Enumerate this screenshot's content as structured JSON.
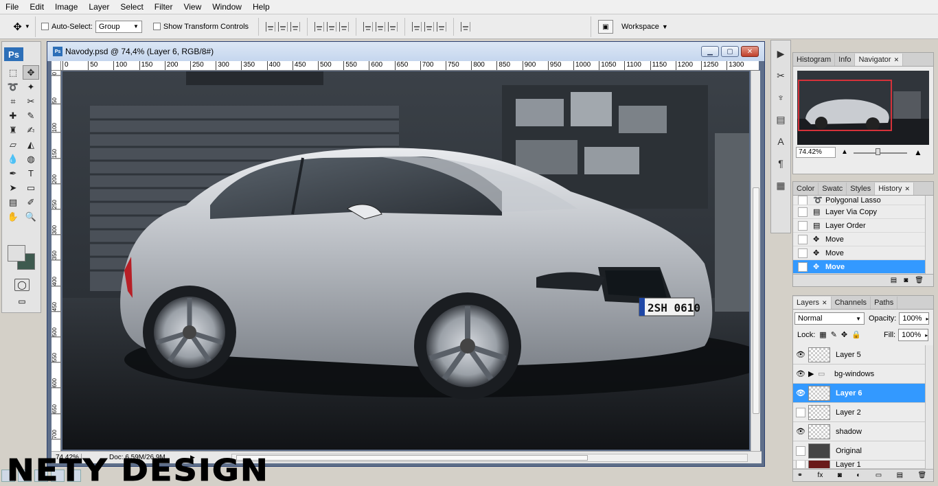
{
  "menu": [
    "File",
    "Edit",
    "Image",
    "Layer",
    "Select",
    "Filter",
    "View",
    "Window",
    "Help"
  ],
  "options": {
    "auto_select_label": "Auto-Select:",
    "auto_select_value": "Group",
    "show_transform_label": "Show Transform Controls",
    "workspace_label": "Workspace"
  },
  "toolbox": {
    "badge": "Ps"
  },
  "document": {
    "title": "Navody.psd @ 74,4% (Layer 6, RGB/8#)",
    "ruler_h": [
      "0",
      "50",
      "100",
      "150",
      "200",
      "250",
      "300",
      "350",
      "400",
      "450",
      "500",
      "550",
      "600",
      "650",
      "700",
      "750",
      "800",
      "850",
      "900",
      "950",
      "1000",
      "1050",
      "1100",
      "1150",
      "1200",
      "1250",
      "1300"
    ],
    "ruler_v": [
      "0",
      "50",
      "100",
      "150",
      "200",
      "250",
      "300",
      "350",
      "400",
      "450",
      "500",
      "550",
      "600",
      "650",
      "700"
    ],
    "zoom": "74,42%",
    "doc_size": "Doc: 6,59M/26,9M",
    "plate": "2SH 0610"
  },
  "navigator": {
    "tabs": [
      "Histogram",
      "Info",
      "Navigator"
    ],
    "zoom": "74.42%"
  },
  "history": {
    "tabs": [
      "Color",
      "Swatc",
      "Styles",
      "History"
    ],
    "items": [
      {
        "label": "Polygonal Lasso",
        "icon": "lasso"
      },
      {
        "label": "Layer Via Copy",
        "icon": "doc"
      },
      {
        "label": "Layer Order",
        "icon": "doc"
      },
      {
        "label": "Move",
        "icon": "move"
      },
      {
        "label": "Move",
        "icon": "move"
      },
      {
        "label": "Move",
        "icon": "move"
      }
    ]
  },
  "layers": {
    "tabs": [
      "Layers",
      "Channels",
      "Paths"
    ],
    "blend_mode": "Normal",
    "opacity_label": "Opacity:",
    "opacity": "100%",
    "lock_label": "Lock:",
    "fill_label": "Fill:",
    "fill": "100%",
    "items": [
      {
        "name": "Layer 5",
        "visible": true,
        "type": "layer"
      },
      {
        "name": "bg-windows",
        "visible": true,
        "type": "group"
      },
      {
        "name": "Layer 6",
        "visible": true,
        "type": "layer"
      },
      {
        "name": "Layer 2",
        "visible": false,
        "type": "layer"
      },
      {
        "name": "shadow",
        "visible": true,
        "type": "layer"
      },
      {
        "name": "Original",
        "visible": false,
        "type": "layer"
      },
      {
        "name": "Layer 1",
        "visible": false,
        "type": "layer"
      }
    ]
  },
  "watermark": "NETY DESIGN"
}
